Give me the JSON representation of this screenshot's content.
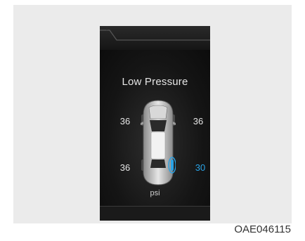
{
  "display": {
    "warning_title": "Low Pressure",
    "unit": "psi",
    "tires": {
      "front_left": "36",
      "front_right": "36",
      "rear_left": "36",
      "rear_right": "30"
    },
    "low_tire": "rear_right",
    "low_tire_color": "#2aa3e6"
  },
  "caption": "OAE046115"
}
